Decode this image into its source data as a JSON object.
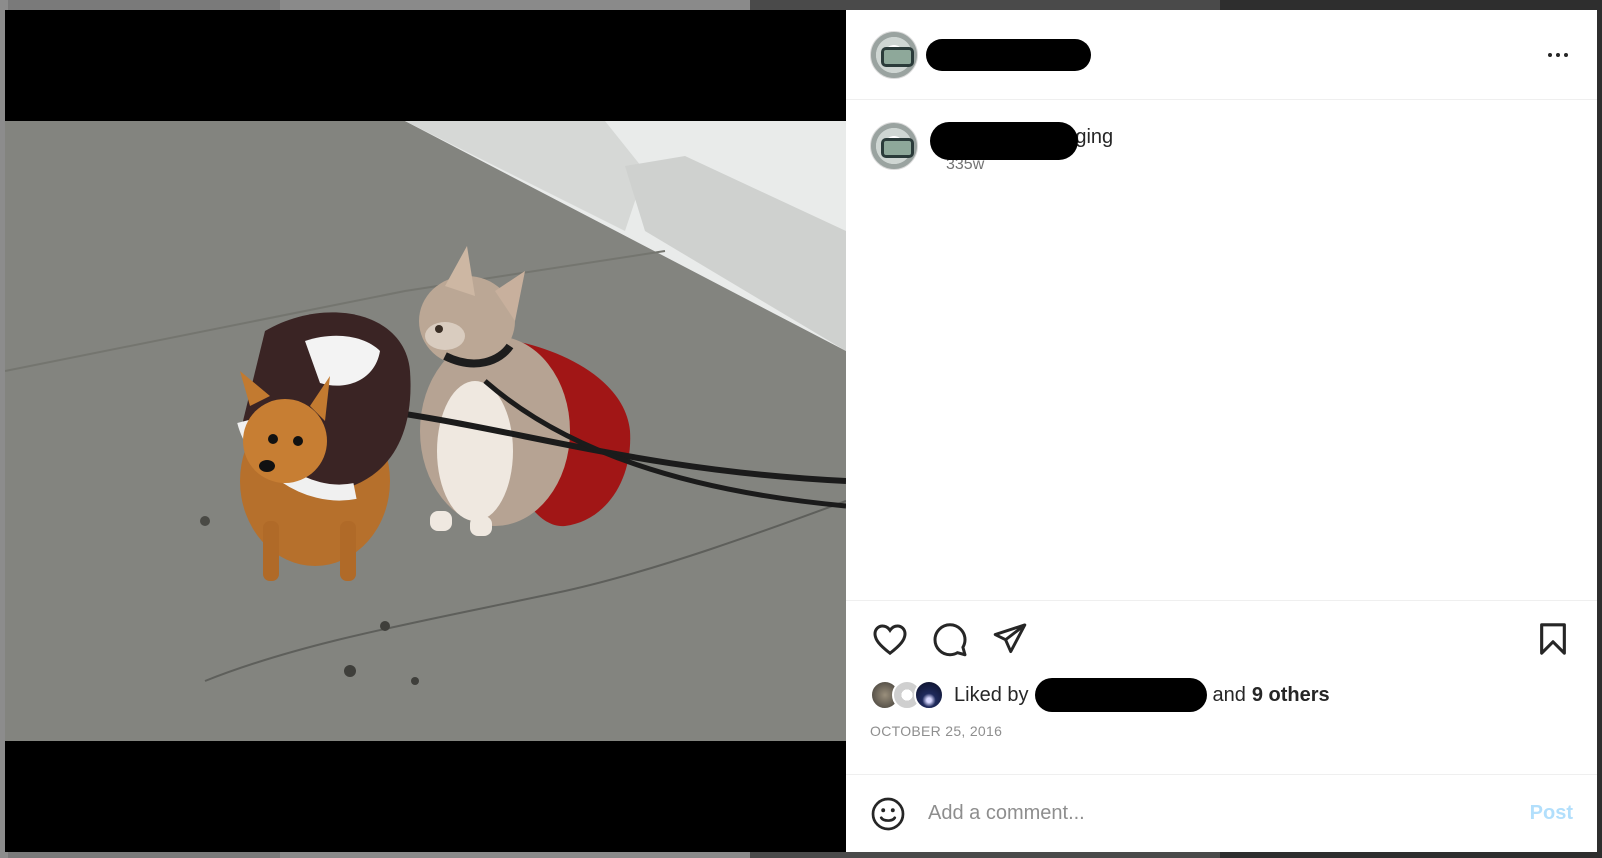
{
  "post": {
    "caption_visible_text": "nanging",
    "caption_time": "335w",
    "likes_prefix": "Liked by",
    "likes_and": "and",
    "likes_count_text": "9 others",
    "date": "OCTOBER 25, 2016"
  },
  "comment_box": {
    "placeholder": "Add a comment...",
    "post_label": "Post"
  },
  "icons": {
    "header_menu": "more-horizontal-icon",
    "like": "heart-icon",
    "comment": "comment-bubble-icon",
    "share": "paper-plane-icon",
    "save": "bookmark-icon",
    "emoji": "smiley-icon"
  },
  "colors": {
    "post_button": "#b2dffc",
    "meta_gray": "#8e8e8e",
    "divider": "#efefef"
  }
}
